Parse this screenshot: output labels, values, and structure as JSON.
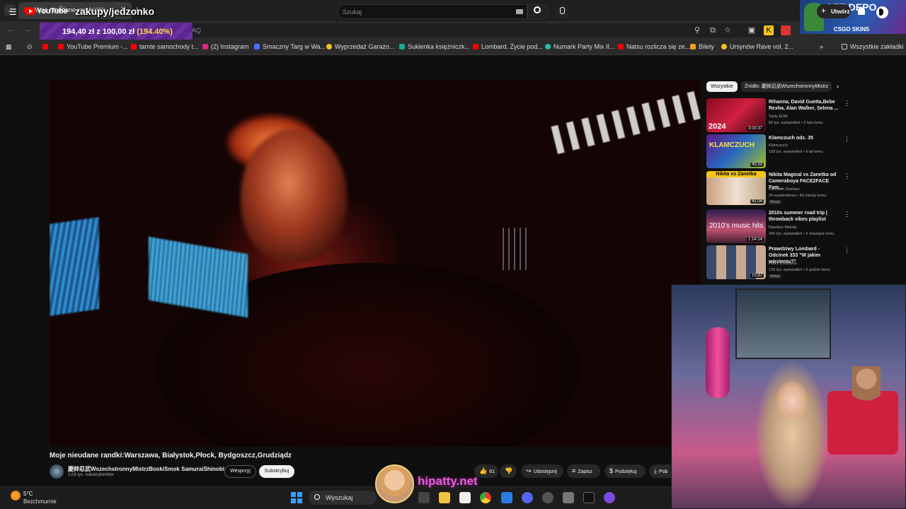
{
  "browser": {
    "active_tab_title": "Moje nieudane randki:Wa",
    "stream_overlay": "zakupy/jedzonko",
    "omnibox_fragment": "FAQ",
    "donation": {
      "amount": "194,40 zł z 100,00 zł",
      "percent": "(194.40%)"
    },
    "bookmarks": [
      {
        "label": "YouTube Premium -...",
        "color": "#ff0000"
      },
      {
        "label": "tamte samochody t...",
        "color": "#ff0000"
      },
      {
        "label": "(2) Instagram",
        "color": "#d62976"
      },
      {
        "label": "Smaczny Targ w Wa...",
        "color": "#4a6cff"
      },
      {
        "label": "Wyprzedaż Garażo...",
        "color": "#f0c020"
      },
      {
        "label": "Sukienka księżniczk...",
        "color": "#1aa890"
      },
      {
        "label": "Lombard. Życie pod...",
        "color": "#ff0000"
      },
      {
        "label": "Numark Party Mix II...",
        "color": "#20c0a0"
      },
      {
        "label": "Natsu rozlicza się ze...",
        "color": "#ff0000"
      },
      {
        "label": "Bilety",
        "color": "#f0a020"
      },
      {
        "label": "Ursynów Rave vol. 2...",
        "color": "#f0c020"
      }
    ],
    "all_bookmarks": "Wszystkie zakładki"
  },
  "ad": {
    "headline": "GET DEPO",
    "brand": "CSGO SKINS"
  },
  "youtube": {
    "logo": "YouTube",
    "logo_region": "PL",
    "search_placeholder": "Szukaj",
    "create_label": "Utwórz"
  },
  "video": {
    "title": "Moje nieudane randki:Warszawa, Białystok,Płock, Bydgoszcz,Grudziądz",
    "channel": "慶帥忍武WszechstronnyMistrzBoskiSmok SamuraiShinobi",
    "subscribers": "2,03 tys. subskrybentów",
    "join": "Wesprzyj",
    "subscribe": "Subskrybuj",
    "likes": "61",
    "share": "Udostępnij",
    "save": "Zapisz",
    "thanks": "Podziękuj",
    "download": "Pob"
  },
  "sidebar": {
    "chip_all": "Wszystkie",
    "chip_source": "Źródło: 慶帥忍武WszechstronnyMistrz",
    "recommendations": [
      {
        "title": "Rihanna, David Guetta,Bebe Rexha, Alan Walker, Selena ...",
        "channel": "Tasty EDM",
        "meta": "60 tys. wyświetleń • 2 lata temu",
        "duration": "3:03:37",
        "thumb_label": "2024",
        "new": ""
      },
      {
        "title": "Klamczuch odc. 35",
        "channel": "Klamczuch",
        "meta": "128 tys. wyświetleń • 9 lat temu",
        "duration": "45:33",
        "thumb_label": "KLAMCZUCH",
        "new": ""
      },
      {
        "title": "Nikita Magical vs Zanetka od Cameraboya FACE2FACE Fam...",
        "channel": "Damiano Damiani",
        "meta": "24 wyświetlenia • 43 minuty temu",
        "duration": "41:04",
        "thumb_label": "Nikita vs Zanetka",
        "new": "Nowy"
      },
      {
        "title": "2010s summer road trip | throwback vibes playlist",
        "channel": "Random Melody",
        "meta": "266 tys. wyświetleń • 3 miesiące temu",
        "duration": "1:14:14",
        "thumb_label": "2010's music hits",
        "new": ""
      },
      {
        "title": "Prawdziwy Lombard - Odcinek 333 \"W jakim więzieniu?\"",
        "channel": "Pan z Lombardu",
        "meta": "139 tys. wyświetleń • 5 godzin temu",
        "duration": "15:37",
        "thumb_label": "",
        "new": "Nowy"
      }
    ]
  },
  "overlay": {
    "brand": "hipatty.net"
  },
  "taskbar": {
    "temp": "5°C",
    "weather": "Bezchmurnie",
    "search": "Wyszukaj"
  }
}
